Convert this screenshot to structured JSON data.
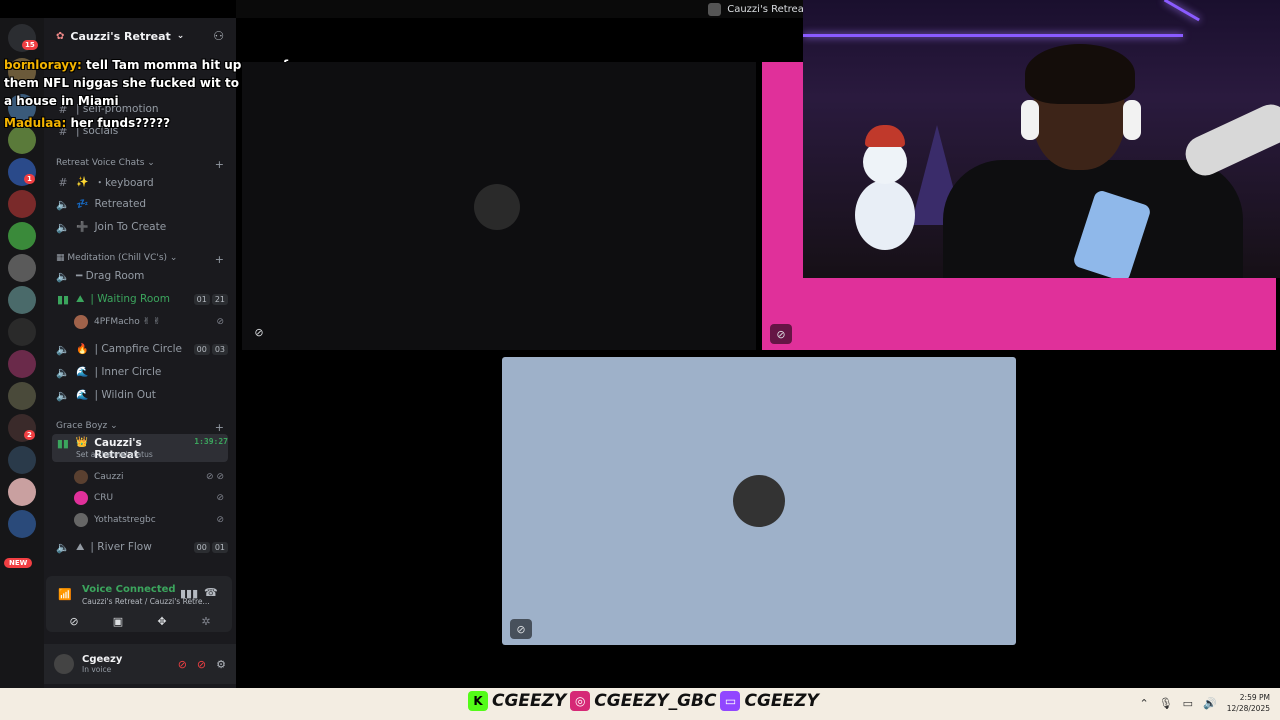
{
  "window": {
    "title": "Cauzzi's Retreat"
  },
  "server": {
    "name": "Cauzzi's Retreat"
  },
  "rail": {
    "badges": [
      {
        "text": "15"
      },
      {
        "text": "1"
      },
      {
        "text": "2"
      }
    ],
    "new_label": "NEW"
  },
  "channels": {
    "top": [
      {
        "name": "| self-promotion"
      },
      {
        "name": "| socials"
      }
    ],
    "retreat_voice_label": "Retreat Voice Chats",
    "retreat_voice": [
      {
        "emoji": "✨",
        "name": "・keyboard"
      },
      {
        "emoji": "💤",
        "name": "Retreated"
      },
      {
        "emoji": "➕",
        "name": "Join To Create"
      }
    ],
    "meditation_label": "Meditation (Chill VC's)",
    "drag_room": "━ Drag Room",
    "waiting_room": {
      "name": "| Waiting Room",
      "counts": [
        "01",
        "21"
      ]
    },
    "waiting_user": {
      "name": "4PFMacho ✌ ✌"
    },
    "campfire": {
      "name": "| Campfire Circle",
      "counts": [
        "00",
        "03"
      ]
    },
    "inner_circle": {
      "name": "| Inner Circle"
    },
    "wildin_out": {
      "name": "| Wildin Out"
    },
    "grace_label": "Grace Boyz",
    "active_channel": {
      "name": "Cauzzi's Retreat",
      "timer": "1:39:27",
      "status": "Set a channel status"
    },
    "active_users": [
      {
        "name": "Cauzzi"
      },
      {
        "name": "CRU"
      },
      {
        "name": "Yothatstregbc"
      }
    ],
    "river_flow": {
      "name": "| River Flow",
      "counts": [
        "00",
        "01"
      ]
    }
  },
  "voice": {
    "title": "Voice Connected",
    "sub": "Cauzzi's Retreat / Cauzzi's Retre..."
  },
  "user": {
    "name": "Cgeezy",
    "status": "In voice"
  },
  "chat": [
    {
      "user": "bornlorayy:",
      "text": "tell Tam momma hit up one of them NFL niggas she fucked wit to give up a house in Miami"
    },
    {
      "user": "Madulaa:",
      "text": "her funds?????"
    }
  ],
  "taskbar": {
    "brand": [
      "CGEEZY",
      "CGEEZY_GBC",
      "CGEEZY"
    ],
    "time": "2:59 PM",
    "date": "12/28/2025"
  },
  "colors": {
    "accent_green": "#3ba55d",
    "tile_pink": "#e0309a",
    "tile_blue": "#9eb1c9",
    "badge_red": "#f23f43"
  }
}
